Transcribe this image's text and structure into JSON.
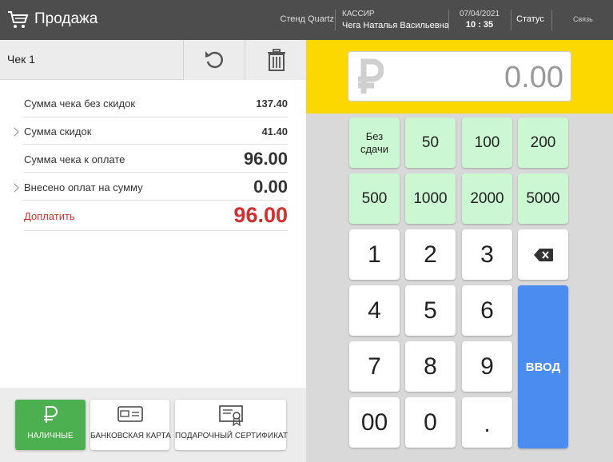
{
  "header": {
    "title": "Продажа",
    "stand": "Стенд Quartz",
    "cashier_role": "КАССИР",
    "cashier_name": "Чега Наталья Васильевна",
    "date": "07/04/2021",
    "time": "10 : 35",
    "status": "Статус",
    "link": "Связь"
  },
  "check": {
    "title": "Чек 1",
    "undo_icon": "undo-icon",
    "delete_icon": "trash-icon"
  },
  "summary": {
    "no_discount_label": "Сумма чека без скидок",
    "no_discount_value": "137.40",
    "discount_label": "Сумма скидок",
    "discount_value": "41.40",
    "to_pay_label": "Сумма чека к оплате",
    "to_pay_value": "96.00",
    "paid_label": "Внесено оплат на сумму",
    "paid_value": "0.00",
    "due_label": "Доплатить",
    "due_value": "96.00"
  },
  "payment": {
    "cash": "НАЛИЧНЫЕ",
    "card": "БАНКОВСКАЯ КАРТА",
    "gift": "ПОДАРОЧНЫЙ СЕРТИФИКАТ"
  },
  "amount": {
    "value": "0.00"
  },
  "keypad": {
    "no_change_1": "Без",
    "no_change_2": "сдачи",
    "b50": "50",
    "b100": "100",
    "b200": "200",
    "b500": "500",
    "b1000": "1000",
    "b2000": "2000",
    "b5000": "5000",
    "k1": "1",
    "k2": "2",
    "k3": "3",
    "k4": "4",
    "k5": "5",
    "k6": "6",
    "k7": "7",
    "k8": "8",
    "k9": "9",
    "k00": "00",
    "k0": "0",
    "kdot": ".",
    "enter": "ВВОД"
  },
  "colors": {
    "header": "#4d4d4d",
    "accent_yellow": "#fdd800",
    "money_key": "#cbf7d2",
    "enter_key": "#4a8cf0",
    "cash_active": "#4caf50",
    "due_red": "#d32f2f"
  }
}
